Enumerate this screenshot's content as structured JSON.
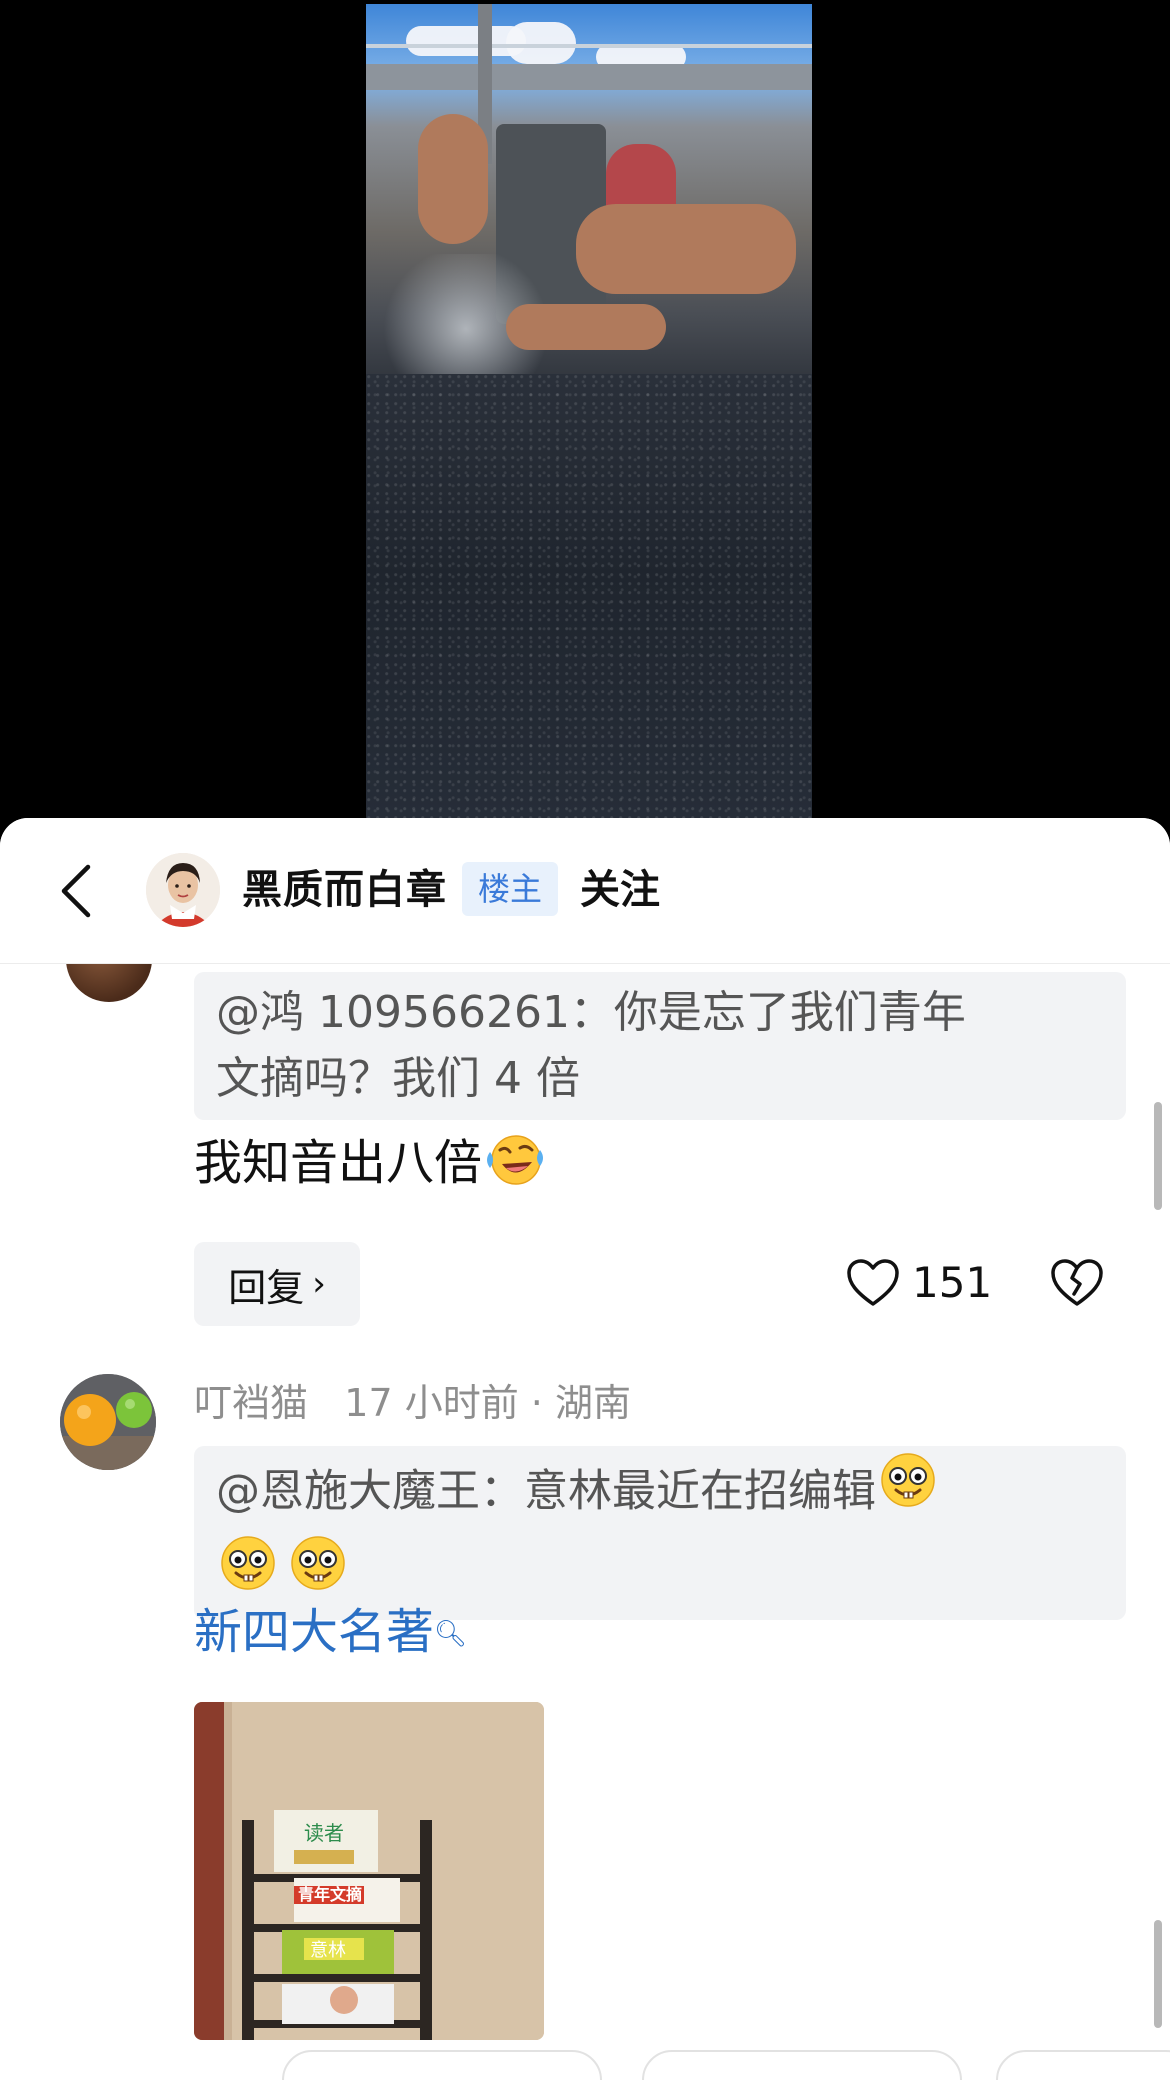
{
  "original_poster": {
    "name": "黑质而白章",
    "badge": "楼主",
    "follow_label": "关注"
  },
  "comment1": {
    "quote": "@鸿 109566261：你是忘了我们青年文摘吗？我们 4 倍",
    "quote_line1": "@鸿 109566261：你是忘了我们青年",
    "quote_line2": "文摘吗？我们 4 倍",
    "text": "我知音出八倍",
    "emoji": "laughing-crying-emoji",
    "reply_label": "回复",
    "likes": "151"
  },
  "comment2": {
    "username": "叮裆猫",
    "time": "17 小时前",
    "separator": "·",
    "location": "湖南",
    "quote_line1": "@恩施大魔王：意林最近在招编辑",
    "text_link": "新四大名著",
    "emoji": "silly-face-emoji",
    "thumb_magazines": [
      "读者",
      "青年文摘",
      "意林"
    ]
  },
  "colors": {
    "link": "#2a6fc4",
    "badge_bg": "#e8f1fc",
    "badge_text": "#3a7ad9",
    "quote_bg": "#f2f3f5"
  }
}
